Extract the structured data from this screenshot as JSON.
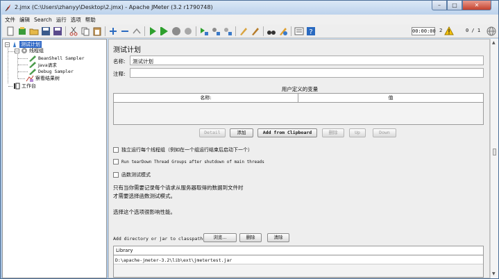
{
  "window": {
    "title": "2.jmx (C:\\Users\\zhanyy\\Desktop\\2.jmx) - Apache JMeter (3.2 r1790748)"
  },
  "menu": [
    "文件",
    "编辑",
    "Search",
    "运行",
    "选项",
    "帮助"
  ],
  "status": {
    "elapsed": "00:00:00",
    "errors": "2",
    "threads": "0 / 1"
  },
  "tree": {
    "root": "测试计划",
    "group": "线程组",
    "samplers": [
      "BeanShell Sampler",
      "Java请求",
      "Debug Sampler"
    ],
    "listener": "察看结果树",
    "workbench": "工作台"
  },
  "panel": {
    "title": "测试计划",
    "name_label": "名称:",
    "name_value": "测试计划",
    "comment_label": "注释:",
    "comment_value": "",
    "uvars_title": "用户定义的变量",
    "col_name": "名称:",
    "col_value": "值",
    "buttons": {
      "detail": "Detail",
      "add": "添加",
      "add_clip": "Add from Clipboard",
      "delete": "删除",
      "up": "Up",
      "down": "Down"
    },
    "opt_serialize": "独立运行每个线程组（例如在一个组运行结束后启动下一个）",
    "opt_teardown": "Run tearDown Thread Groups after shutdown of main threads",
    "opt_functional": "函数测试模式",
    "note_line1": "只有当你需要记录每个请求从服务器取得的数据到文件时",
    "note_line2": "才需要选择函数测试模式。",
    "note_line3": "选择这个选项很影响性能。",
    "classpath_label": "Add directory or jar to classpath",
    "browse": "浏览...",
    "cp_delete": "删除",
    "cp_clear": "清除",
    "lib_header": "Library",
    "lib_row": "D:\\apache-jmeter-3.2\\lib\\ext\\jmetertest.jar"
  },
  "colors": {
    "selection": "#3169c6",
    "titlebar": "#bcd2ec",
    "close": "#c4412d"
  }
}
